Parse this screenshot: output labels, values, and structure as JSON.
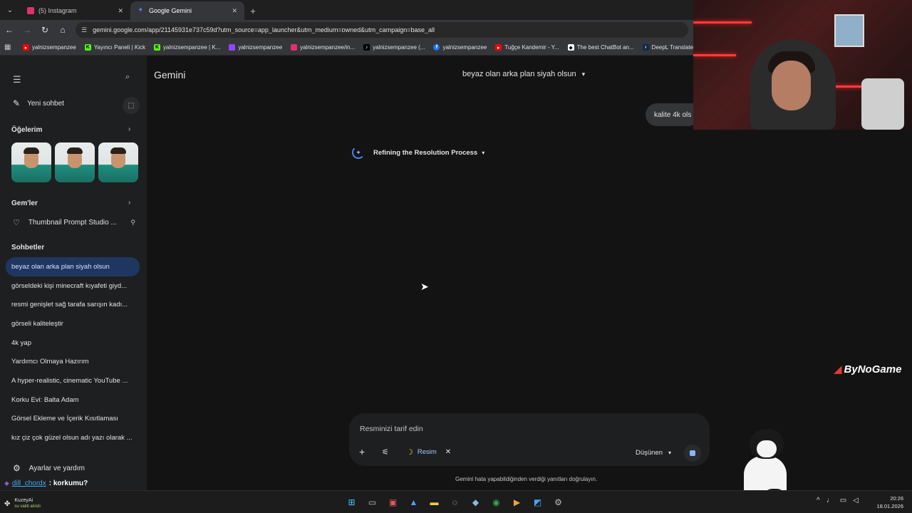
{
  "browser": {
    "tabs": [
      {
        "title": "(5) Instagram",
        "icon": "instagram-icon",
        "color": "#e1306c"
      },
      {
        "title": "Google Gemini",
        "icon": "gemini-icon",
        "color": "#4285f4"
      }
    ],
    "url": "gemini.google.com/app/21145931e737c59d?utm_source=app_launcher&utm_medium=owned&utm_campaign=base_all",
    "bookmarks": [
      {
        "label": "yalnizsempanzee",
        "icon": "youtube-icon",
        "color": "#ff0000"
      },
      {
        "label": "Yayıncı Paneli | Kick",
        "icon": "kick-icon",
        "color": "#53fc18"
      },
      {
        "label": "yalnizsempanzee | K...",
        "icon": "kick-icon",
        "color": "#53fc18"
      },
      {
        "label": "yalnizsempanzee",
        "icon": "twitch-icon",
        "color": "#9146ff"
      },
      {
        "label": "yalnizsempanzee/in...",
        "icon": "instagram-icon",
        "color": "#e1306c"
      },
      {
        "label": "yalnizsempanzee (...",
        "icon": "tiktok-icon",
        "color": "#000000"
      },
      {
        "label": "yalnizsempanzee",
        "icon": "facebook-icon",
        "color": "#1877f2"
      },
      {
        "label": "Tuğçe Kandemir - Y...",
        "icon": "youtube-icon",
        "color": "#ff0000"
      },
      {
        "label": "The best ChatBot an...",
        "icon": "chatbot-icon",
        "color": "#ffffff"
      },
      {
        "label": "DeepL Translate",
        "icon": "deepl-icon",
        "color": "#0f2b46"
      }
    ]
  },
  "sidebar": {
    "new_chat": "Yeni sohbet",
    "items_heading": "Öğelerim",
    "gems_heading": "Gem'ler",
    "gem_item": "Thumbnail Prompt Studio ...",
    "chats_heading": "Sohbetler",
    "chats": [
      "beyaz olan arka plan siyah olsun",
      "görseldeki kişi minecraft kıyafeti giyd...",
      "resmi genişlet sağ tarafa sarışın kadı...",
      "görseli kaliteleştir",
      "4k yap",
      "Yardımcı Olmaya Hazırım",
      "A hyper-realistic, cinematic YouTube ...",
      "Korku Evi: Balta Adam",
      "Görsel Ekleme ve İçerik Kısıtlaması",
      "kız çiz çok güzel olsun adı yazı olarak ..."
    ],
    "settings": "Ayarlar ve yardım"
  },
  "main": {
    "brand": "Gemini",
    "chat_title": "beyaz olan arka plan siyah olsun",
    "user_message": "kalite 4k ols",
    "thinking_label": "Refining the Resolution Process",
    "input_placeholder": "Resminizi tarif edin",
    "tool_chip": "Resim",
    "mode": "Düşünen",
    "disclaimer": "Gemini hata yapabildiğinden verdiği yanıtları doğrulayın."
  },
  "overlay": {
    "logo": "ByNoGame",
    "chat_user": "dill_chordx",
    "chat_message": ": korkumu?"
  },
  "taskbar": {
    "weather_title": "KuzeyAi",
    "weather_sub": "su vakti alındı",
    "time": "20:26",
    "date": "18.01.2026"
  }
}
